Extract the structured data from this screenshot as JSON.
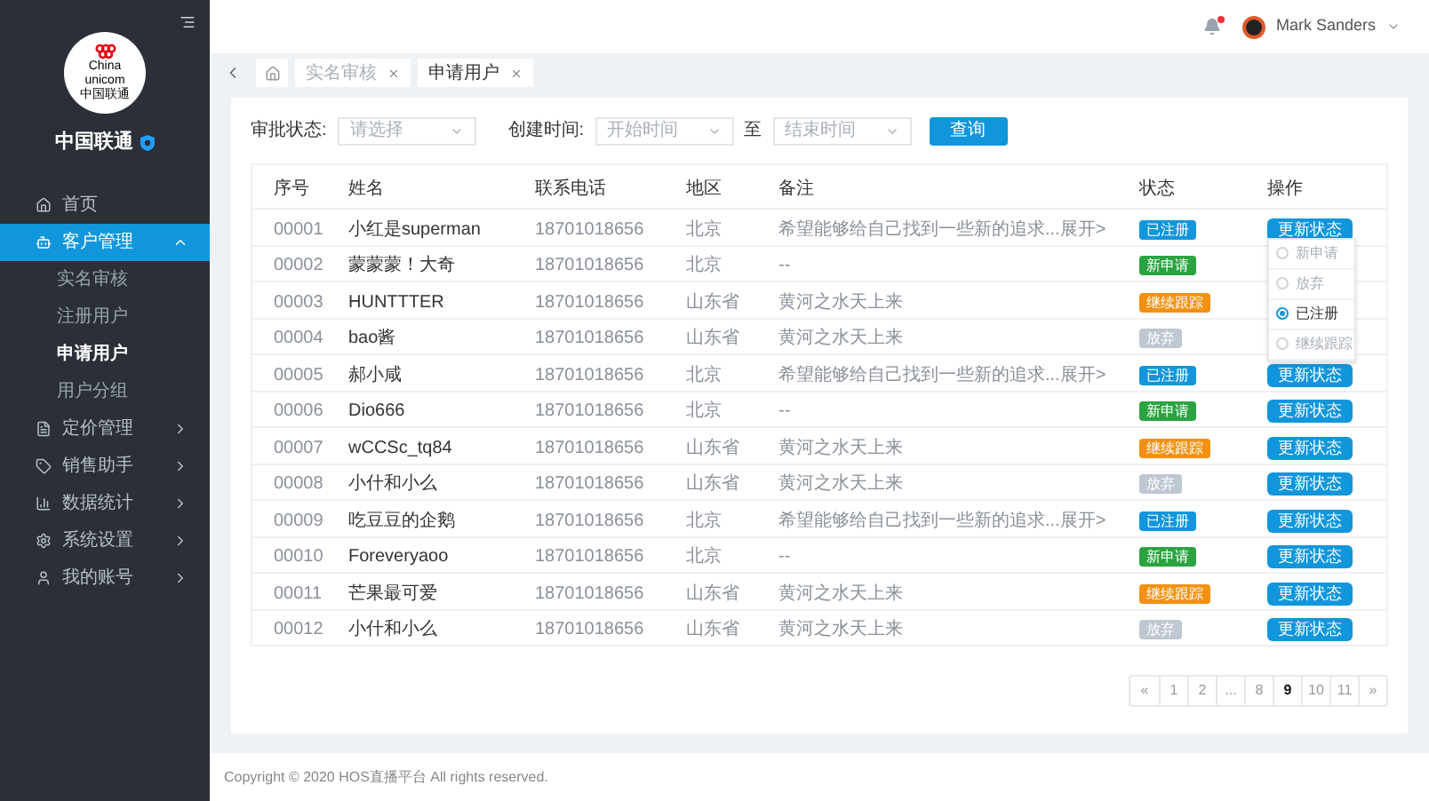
{
  "sidebar": {
    "logo_text": [
      "China",
      "unicom",
      "中国联通"
    ],
    "brand": "中国联通",
    "menu": [
      {
        "label": "首页",
        "selected": false
      },
      {
        "label": "客户管理",
        "selected": true,
        "expanded": true,
        "children": [
          {
            "label": "实名审核",
            "selected": false
          },
          {
            "label": "注册用户",
            "selected": false
          },
          {
            "label": "申请用户",
            "selected": true
          },
          {
            "label": "用户分组",
            "selected": false
          }
        ]
      },
      {
        "label": "定价管理",
        "selected": false,
        "expanded": false
      },
      {
        "label": "销售助手",
        "selected": false,
        "expanded": false
      },
      {
        "label": "数据统计",
        "selected": false,
        "expanded": false
      },
      {
        "label": "系统设置",
        "selected": false,
        "expanded": false
      },
      {
        "label": "我的账号",
        "selected": false,
        "expanded": false
      }
    ]
  },
  "header": {
    "user_name": "Mark Sanders",
    "has_notification": true
  },
  "tabs": [
    {
      "label": "实名审核",
      "selected": false
    },
    {
      "label": "申请用户",
      "selected": true
    }
  ],
  "filters": {
    "status_label": "审批状态:",
    "status_placeholder": "请选择",
    "date_label": "创建时间:",
    "start_placeholder": "开始时间",
    "to": "至",
    "end_placeholder": "结束时间",
    "query_button": "查询"
  },
  "table": {
    "columns": [
      "序号",
      "姓名",
      "联系电话",
      "地区",
      "备注",
      "状态",
      "操作"
    ],
    "rows": [
      {
        "id": "00001",
        "name": "小红是superman",
        "phone": "18701018656",
        "region": "北京",
        "note": "希望能够给自己找到一些新的追求...展开>",
        "status": {
          "label": "已注册",
          "color": "#1296db"
        },
        "action": "更新状态"
      },
      {
        "id": "00002",
        "name": "蒙蒙蒙！大奇",
        "phone": "18701018656",
        "region": "北京",
        "note": "--",
        "status": {
          "label": "新申请",
          "color": "#2ba341"
        }
      },
      {
        "id": "00003",
        "name": "HUNTTTER",
        "phone": "18701018656",
        "region": "山东省",
        "note": "黄河之水天上来",
        "status": {
          "label": "继续跟踪",
          "color": "#f29111"
        }
      },
      {
        "id": "00004",
        "name": "bao酱",
        "phone": "18701018656",
        "region": "山东省",
        "note": "黄河之水天上来",
        "status": {
          "label": "放弃",
          "color": "#bfc7d1"
        }
      },
      {
        "id": "00005",
        "name": "郝小咸",
        "phone": "18701018656",
        "region": "北京",
        "note": "希望能够给自己找到一些新的追求...展开>",
        "status": {
          "label": "已注册",
          "color": "#1296db"
        },
        "action": "更新状态"
      },
      {
        "id": "00006",
        "name": "Dio666",
        "phone": "18701018656",
        "region": "北京",
        "note": "--",
        "status": {
          "label": "新申请",
          "color": "#2ba341"
        },
        "action": "更新状态"
      },
      {
        "id": "00007",
        "name": "wCCSc_tq84",
        "phone": "18701018656",
        "region": "山东省",
        "note": "黄河之水天上来",
        "status": {
          "label": "继续跟踪",
          "color": "#f29111"
        },
        "action": "更新状态"
      },
      {
        "id": "00008",
        "name": "小什和小么",
        "phone": "18701018656",
        "region": "山东省",
        "note": "黄河之水天上来",
        "status": {
          "label": "放弃",
          "color": "#bfc7d1"
        },
        "action": "更新状态"
      },
      {
        "id": "00009",
        "name": "吃豆豆的企鹅",
        "phone": "18701018656",
        "region": "北京",
        "note": "希望能够给自己找到一些新的追求...展开>",
        "status": {
          "label": "已注册",
          "color": "#1296db"
        },
        "action": "更新状态"
      },
      {
        "id": "00010",
        "name": "Foreveryaoo",
        "phone": "18701018656",
        "region": "北京",
        "note": "--",
        "status": {
          "label": "新申请",
          "color": "#2ba341"
        },
        "action": "更新状态"
      },
      {
        "id": "00011",
        "name": "芒果最可爱",
        "phone": "18701018656",
        "region": "山东省",
        "note": "黄河之水天上来",
        "status": {
          "label": "继续跟踪",
          "color": "#f29111"
        },
        "action": "更新状态"
      },
      {
        "id": "00012",
        "name": "小什和小么",
        "phone": "18701018656",
        "region": "山东省",
        "note": "黄河之水天上来",
        "status": {
          "label": "放弃",
          "color": "#bfc7d1"
        },
        "action": "更新状态"
      }
    ]
  },
  "status_menu": [
    {
      "label": "新申请",
      "selected": false
    },
    {
      "label": "放弃",
      "selected": false
    },
    {
      "label": "已注册",
      "selected": true
    },
    {
      "label": "继续跟踪",
      "selected": false
    }
  ],
  "pagination": [
    {
      "label": "«",
      "selected": false
    },
    {
      "label": "1",
      "selected": false
    },
    {
      "label": "2",
      "selected": false
    },
    {
      "label": "...",
      "selected": false
    },
    {
      "label": "8",
      "selected": false
    },
    {
      "label": "9",
      "selected": true
    },
    {
      "label": "10",
      "selected": false
    },
    {
      "label": "11",
      "selected": false
    },
    {
      "label": "»",
      "selected": false
    }
  ],
  "footer": "Copyright © 2020 HOS直播平台 All rights reserved."
}
